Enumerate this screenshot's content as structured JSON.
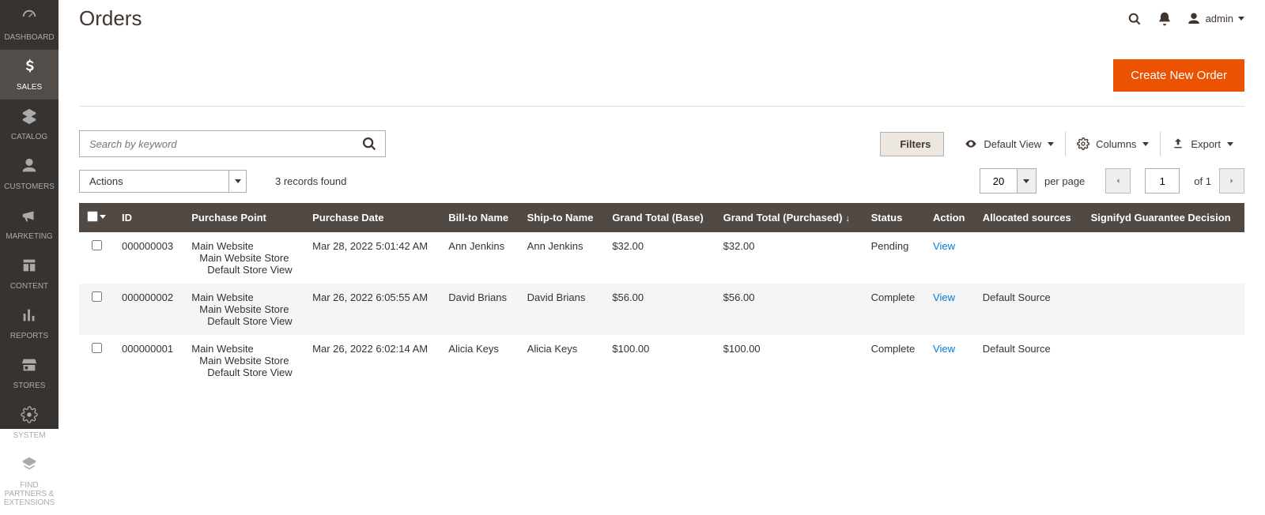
{
  "header": {
    "title": "Orders",
    "user": "admin"
  },
  "sidebar": {
    "items": [
      {
        "label": "DASHBOARD",
        "icon": "dashboard"
      },
      {
        "label": "SALES",
        "icon": "dollar",
        "active": true
      },
      {
        "label": "CATALOG",
        "icon": "catalog"
      },
      {
        "label": "CUSTOMERS",
        "icon": "person"
      },
      {
        "label": "MARKETING",
        "icon": "megaphone"
      },
      {
        "label": "CONTENT",
        "icon": "content"
      },
      {
        "label": "REPORTS",
        "icon": "reports"
      },
      {
        "label": "STORES",
        "icon": "stores"
      },
      {
        "label": "SYSTEM",
        "icon": "system"
      },
      {
        "label": "FIND PARTNERS & EXTENSIONS",
        "icon": "partners"
      }
    ]
  },
  "actions": {
    "create_order": "Create New Order"
  },
  "search": {
    "placeholder": "Search by keyword"
  },
  "toolbar": {
    "filters": "Filters",
    "default_view": "Default View",
    "columns": "Columns",
    "export": "Export"
  },
  "grid_controls": {
    "actions": "Actions",
    "records": "3 records found",
    "page_size": "20",
    "per_page": "per page",
    "current_page": "1",
    "total_pages": "1",
    "of": "of"
  },
  "columns": [
    "",
    "ID",
    "Purchase Point",
    "Purchase Date",
    "Bill-to Name",
    "Ship-to Name",
    "Grand Total (Base)",
    "Grand Total (Purchased)",
    "Status",
    "Action",
    "Allocated sources",
    "Signifyd Guarantee Decision"
  ],
  "sort_column_index": 7,
  "rows": [
    {
      "id": "000000003",
      "pp": [
        "Main Website",
        "Main Website Store",
        "Default Store View"
      ],
      "date": "Mar 28, 2022 5:01:42 AM",
      "bill": "Ann Jenkins",
      "ship": "Ann Jenkins",
      "base": "$32.00",
      "purchased": "$32.00",
      "status": "Pending",
      "action": "View",
      "sources": "",
      "signifyd": ""
    },
    {
      "id": "000000002",
      "pp": [
        "Main Website",
        "Main Website Store",
        "Default Store View"
      ],
      "date": "Mar 26, 2022 6:05:55 AM",
      "bill": "David Brians",
      "ship": "David Brians",
      "base": "$56.00",
      "purchased": "$56.00",
      "status": "Complete",
      "action": "View",
      "sources": "Default Source",
      "signifyd": ""
    },
    {
      "id": "000000001",
      "pp": [
        "Main Website",
        "Main Website Store",
        "Default Store View"
      ],
      "date": "Mar 26, 2022 6:02:14 AM",
      "bill": "Alicia Keys",
      "ship": "Alicia Keys",
      "base": "$100.00",
      "purchased": "$100.00",
      "status": "Complete",
      "action": "View",
      "sources": "Default Source",
      "signifyd": ""
    }
  ]
}
